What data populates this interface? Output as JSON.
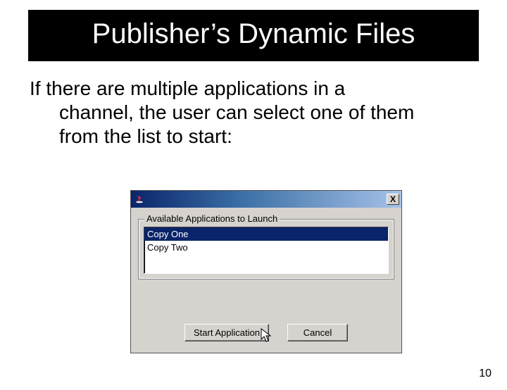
{
  "slide": {
    "title": "Publisher’s Dynamic Files",
    "body_line1": "If there are multiple applications in a",
    "body_line2": "channel, the user can select one of them",
    "body_line3": "from the list to start:",
    "page_number": "10"
  },
  "dialog": {
    "close_glyph": "X",
    "legend": "Available Applications to Launch",
    "items": [
      "Copy One",
      "Copy Two"
    ],
    "selected_index": 0,
    "start_label": "Start Application",
    "cancel_label": "Cancel"
  }
}
